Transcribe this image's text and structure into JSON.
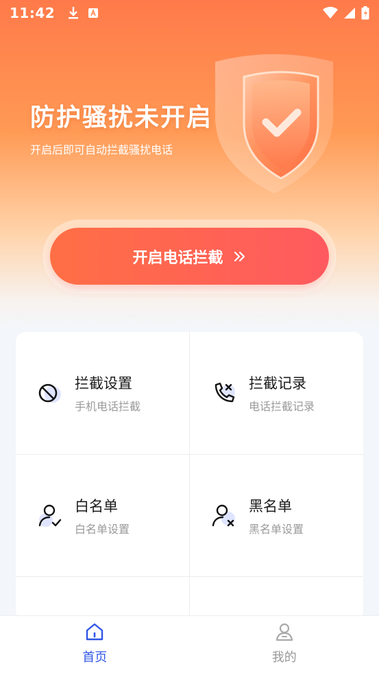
{
  "status_bar": {
    "time": "11:42"
  },
  "hero": {
    "title": "防护骚扰未开启",
    "subtitle": "开启后即可自动拦截骚扰电话",
    "cta_label": "开启电话拦截"
  },
  "features": [
    {
      "title": "拦截设置",
      "subtitle": "手机电话拦截",
      "icon": "block-icon"
    },
    {
      "title": "拦截记录",
      "subtitle": "电话拦截记录",
      "icon": "phone-blocked-icon"
    },
    {
      "title": "白名单",
      "subtitle": "白名单设置",
      "icon": "user-check-icon"
    },
    {
      "title": "黑名单",
      "subtitle": "黑名单设置",
      "icon": "user-x-icon"
    }
  ],
  "tabs": [
    {
      "label": "首页",
      "icon": "home-icon",
      "active": true
    },
    {
      "label": "我的",
      "icon": "profile-icon",
      "active": false
    }
  ],
  "colors": {
    "accent": "#2f56e6",
    "cta_start": "#ff6f45",
    "cta_end": "#ff5a5f",
    "hero_top": "#ff7a4a"
  }
}
